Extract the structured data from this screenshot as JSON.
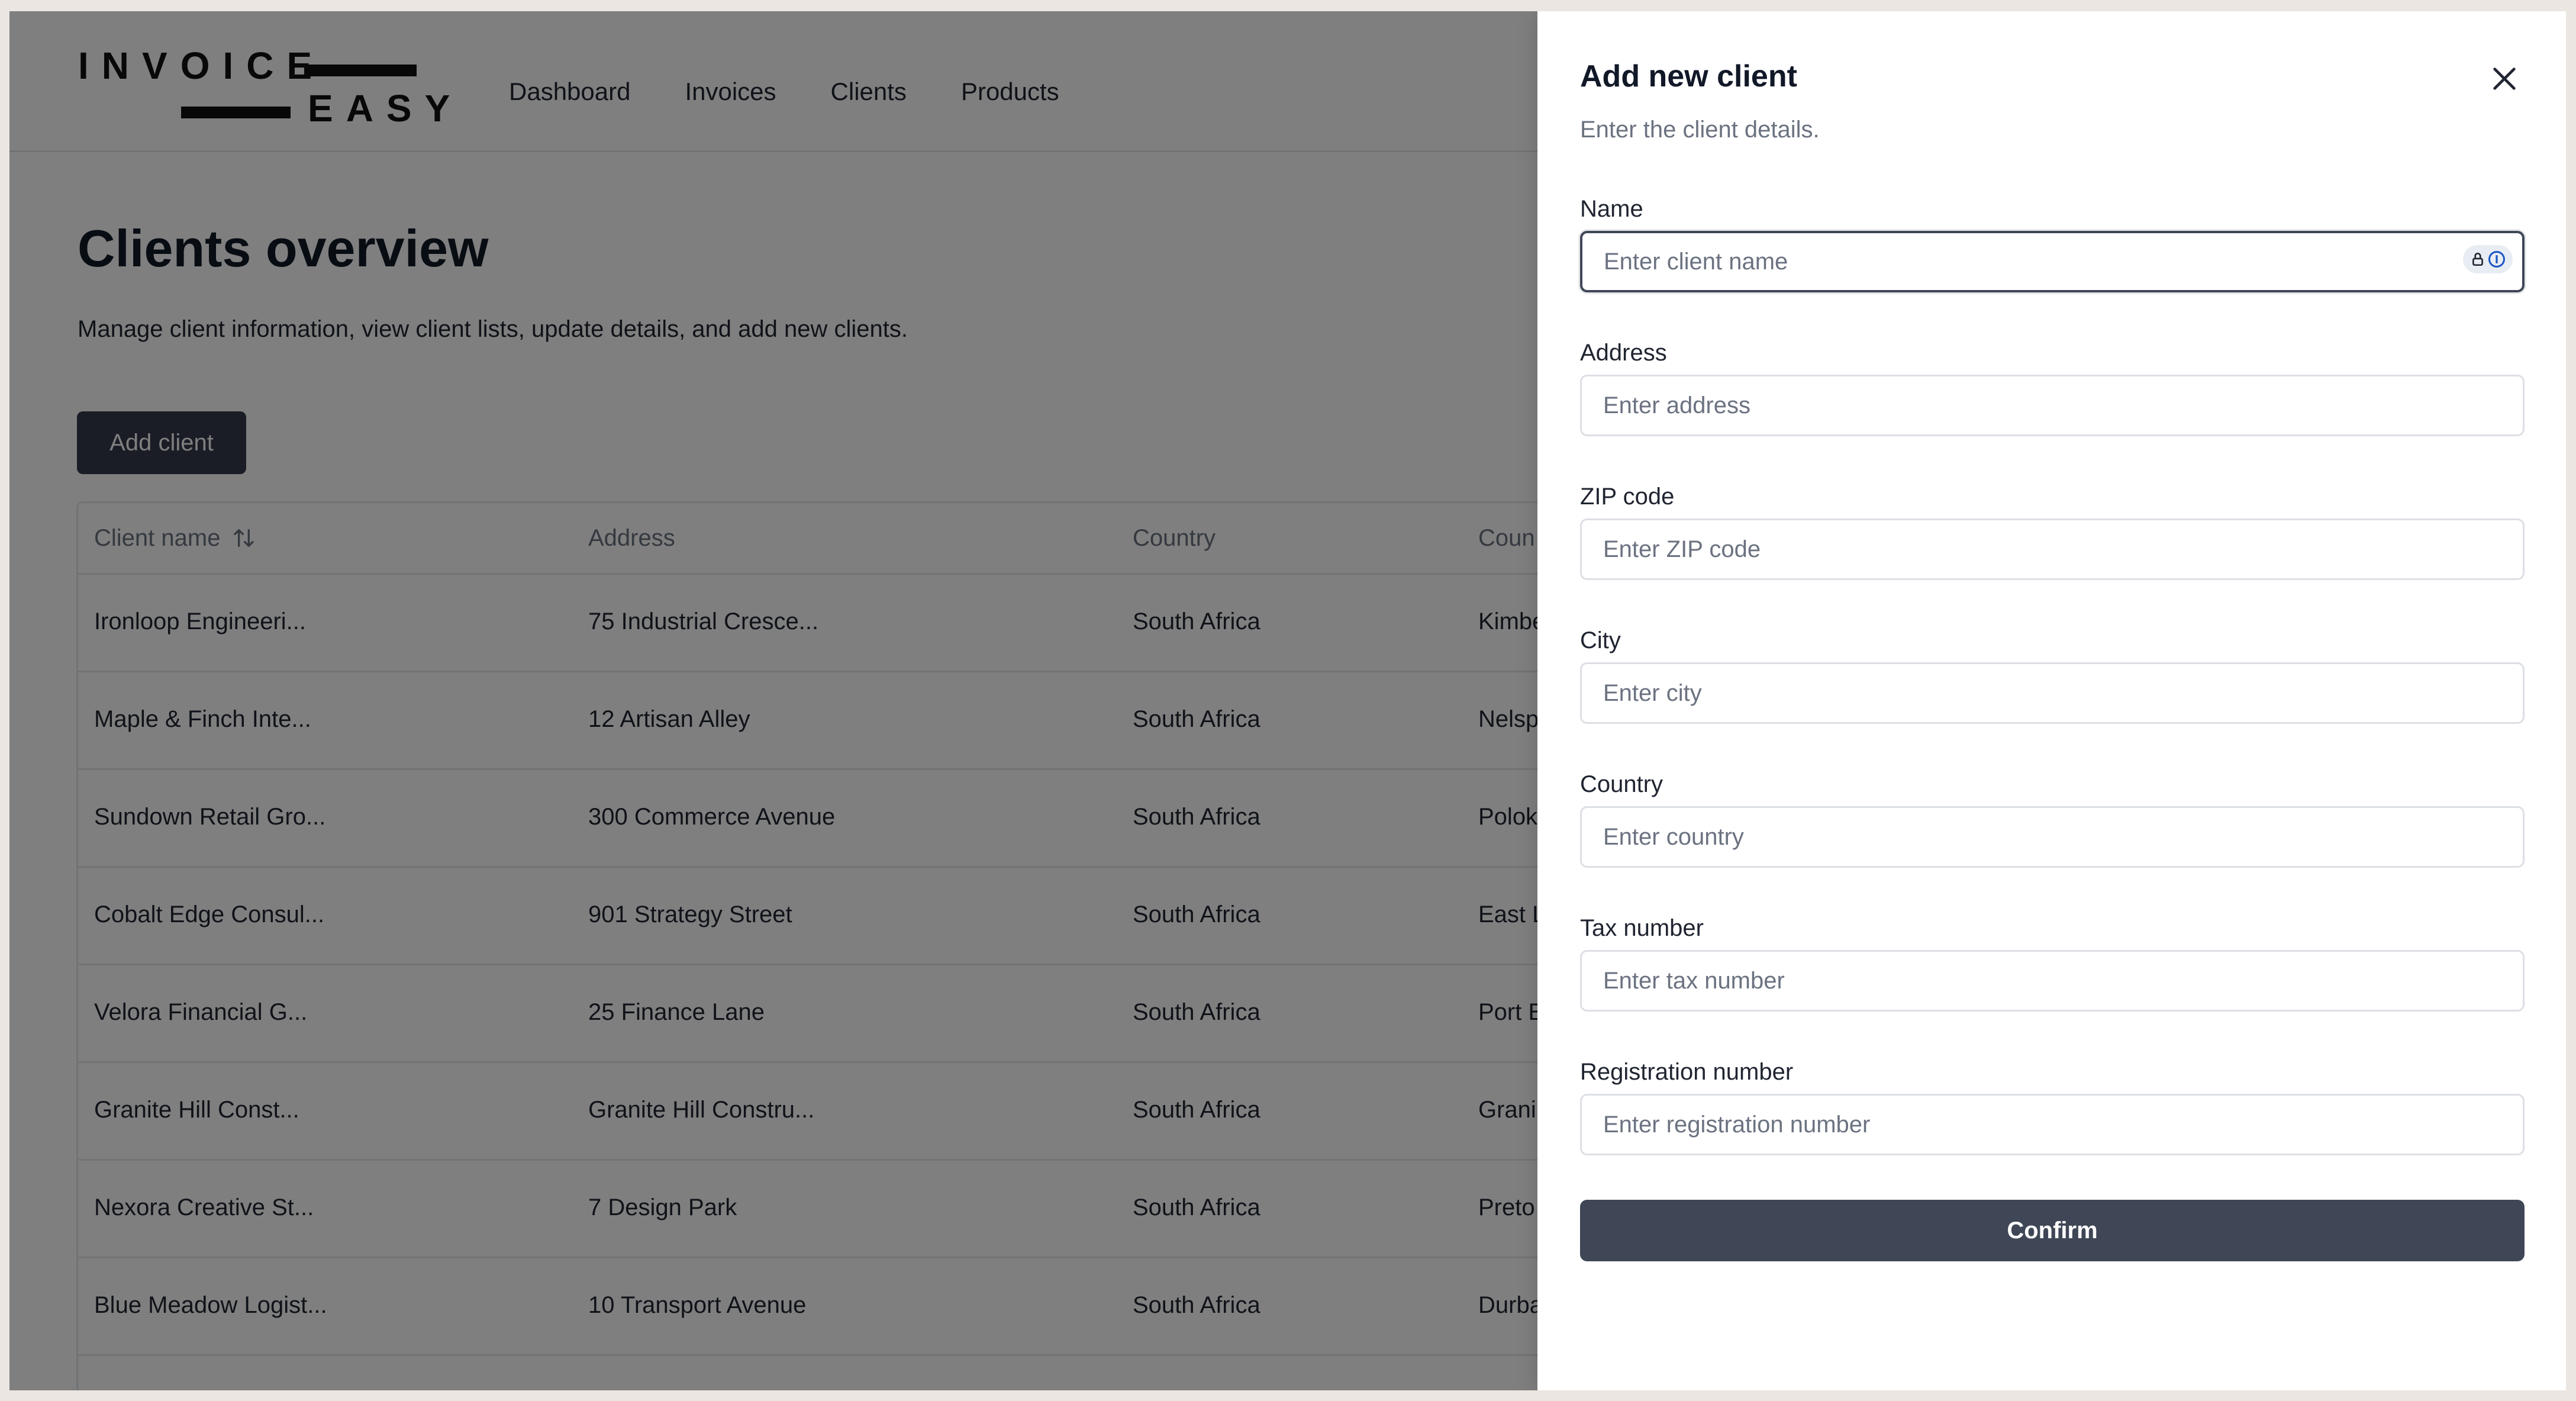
{
  "logo": {
    "line1": "INVOICE",
    "line2": "EASY"
  },
  "nav": [
    "Dashboard",
    "Invoices",
    "Clients",
    "Products"
  ],
  "page": {
    "title": "Clients overview",
    "description": "Manage client information, view client lists, update details, and add new clients.",
    "add_button": "Add client"
  },
  "table": {
    "headers": [
      "Client name",
      "Address",
      "Country",
      "Coun"
    ],
    "sort_icon": "sort-arrows-icon",
    "rows": [
      [
        "Ironloop Engineeri...",
        "75 Industrial Cresce...",
        "South Africa",
        "Kimbe"
      ],
      [
        "Maple & Finch Inte...",
        "12 Artisan Alley",
        "South Africa",
        "Nelsp"
      ],
      [
        "Sundown Retail Gro...",
        "300 Commerce Avenue",
        "South Africa",
        "Polok"
      ],
      [
        "Cobalt Edge Consul...",
        "901 Strategy Street",
        "South Africa",
        "East L"
      ],
      [
        "Velora Financial G...",
        "25 Finance Lane",
        "South Africa",
        "Port E"
      ],
      [
        "Granite Hill Const...",
        "Granite Hill Constru...",
        "South Africa",
        "Grani"
      ],
      [
        "Nexora Creative St...",
        "7 Design Park",
        "South Africa",
        "Preto"
      ],
      [
        "Blue Meadow Logist...",
        "10 Transport Avenue",
        "South Africa",
        "Durba"
      ]
    ]
  },
  "drawer": {
    "title": "Add new client",
    "subtitle": "Enter the client details.",
    "close_icon": "close-icon",
    "password_manager_icon": "password-manager-icon",
    "fields": [
      {
        "label": "Name",
        "placeholder": "Enter client name",
        "value": ""
      },
      {
        "label": "Address",
        "placeholder": "Enter address",
        "value": ""
      },
      {
        "label": "ZIP code",
        "placeholder": "Enter ZIP code",
        "value": ""
      },
      {
        "label": "City",
        "placeholder": "Enter city",
        "value": ""
      },
      {
        "label": "Country",
        "placeholder": "Enter country",
        "value": ""
      },
      {
        "label": "Tax number",
        "placeholder": "Enter tax number",
        "value": ""
      },
      {
        "label": "Registration number",
        "placeholder": "Enter registration number",
        "value": ""
      }
    ],
    "confirm_button": "Confirm"
  },
  "colors": {
    "primary_button": "#343b4c",
    "confirm_button": "#3f4656",
    "overlay": "rgba(0,0,0,0.5)",
    "muted_text": "#6b7280"
  }
}
